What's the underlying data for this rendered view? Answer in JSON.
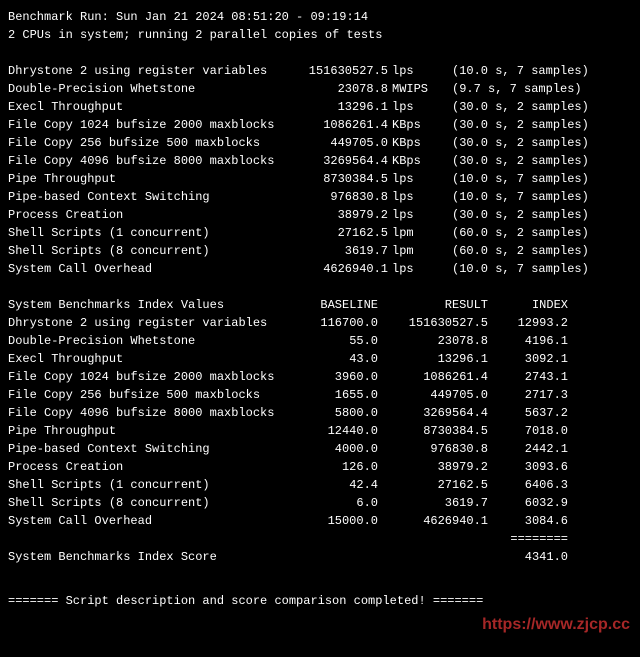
{
  "header": {
    "run_line": "Benchmark Run: Sun Jan 21 2024 08:51:20 - 09:19:14",
    "cpus_line": "2 CPUs in system; running 2 parallel copies of tests"
  },
  "tests": [
    {
      "name": "Dhrystone 2 using register variables",
      "value": "151630527.5",
      "unit": "lps",
      "time": "(10.0 s, 7 samples)"
    },
    {
      "name": "Double-Precision Whetstone",
      "value": "23078.8",
      "unit": "MWIPS",
      "time": "(9.7 s, 7 samples)"
    },
    {
      "name": "Execl Throughput",
      "value": "13296.1",
      "unit": "lps",
      "time": "(30.0 s, 2 samples)"
    },
    {
      "name": "File Copy 1024 bufsize 2000 maxblocks",
      "value": "1086261.4",
      "unit": "KBps",
      "time": "(30.0 s, 2 samples)"
    },
    {
      "name": "File Copy 256 bufsize 500 maxblocks",
      "value": "449705.0",
      "unit": "KBps",
      "time": "(30.0 s, 2 samples)"
    },
    {
      "name": "File Copy 4096 bufsize 8000 maxblocks",
      "value": "3269564.4",
      "unit": "KBps",
      "time": "(30.0 s, 2 samples)"
    },
    {
      "name": "Pipe Throughput",
      "value": "8730384.5",
      "unit": "lps",
      "time": "(10.0 s, 7 samples)"
    },
    {
      "name": "Pipe-based Context Switching",
      "value": "976830.8",
      "unit": "lps",
      "time": "(10.0 s, 7 samples)"
    },
    {
      "name": "Process Creation",
      "value": "38979.2",
      "unit": "lps",
      "time": "(30.0 s, 2 samples)"
    },
    {
      "name": "Shell Scripts (1 concurrent)",
      "value": "27162.5",
      "unit": "lpm",
      "time": "(60.0 s, 2 samples)"
    },
    {
      "name": "Shell Scripts (8 concurrent)",
      "value": "3619.7",
      "unit": "lpm",
      "time": "(60.0 s, 2 samples)"
    },
    {
      "name": "System Call Overhead",
      "value": "4626940.1",
      "unit": "lps",
      "time": "(10.0 s, 7 samples)"
    }
  ],
  "index_header": {
    "label": "System Benchmarks Index Values",
    "baseline": "BASELINE",
    "result": "RESULT",
    "index": "INDEX"
  },
  "index_rows": [
    {
      "name": "Dhrystone 2 using register variables",
      "baseline": "116700.0",
      "result": "151630527.5",
      "index": "12993.2"
    },
    {
      "name": "Double-Precision Whetstone",
      "baseline": "55.0",
      "result": "23078.8",
      "index": "4196.1"
    },
    {
      "name": "Execl Throughput",
      "baseline": "43.0",
      "result": "13296.1",
      "index": "3092.1"
    },
    {
      "name": "File Copy 1024 bufsize 2000 maxblocks",
      "baseline": "3960.0",
      "result": "1086261.4",
      "index": "2743.1"
    },
    {
      "name": "File Copy 256 bufsize 500 maxblocks",
      "baseline": "1655.0",
      "result": "449705.0",
      "index": "2717.3"
    },
    {
      "name": "File Copy 4096 bufsize 8000 maxblocks",
      "baseline": "5800.0",
      "result": "3269564.4",
      "index": "5637.2"
    },
    {
      "name": "Pipe Throughput",
      "baseline": "12440.0",
      "result": "8730384.5",
      "index": "7018.0"
    },
    {
      "name": "Pipe-based Context Switching",
      "baseline": "4000.0",
      "result": "976830.8",
      "index": "2442.1"
    },
    {
      "name": "Process Creation",
      "baseline": "126.0",
      "result": "38979.2",
      "index": "3093.6"
    },
    {
      "name": "Shell Scripts (1 concurrent)",
      "baseline": "42.4",
      "result": "27162.5",
      "index": "6406.3"
    },
    {
      "name": "Shell Scripts (8 concurrent)",
      "baseline": "6.0",
      "result": "3619.7",
      "index": "6032.9"
    },
    {
      "name": "System Call Overhead",
      "baseline": "15000.0",
      "result": "4626940.1",
      "index": "3084.6"
    }
  ],
  "separator": "========",
  "score": {
    "label": "System Benchmarks Index Score",
    "value": "4341.0"
  },
  "footer": {
    "completed": "======= Script description and score comparison completed! ======="
  },
  "watermark": "https://www.zjcp.cc"
}
